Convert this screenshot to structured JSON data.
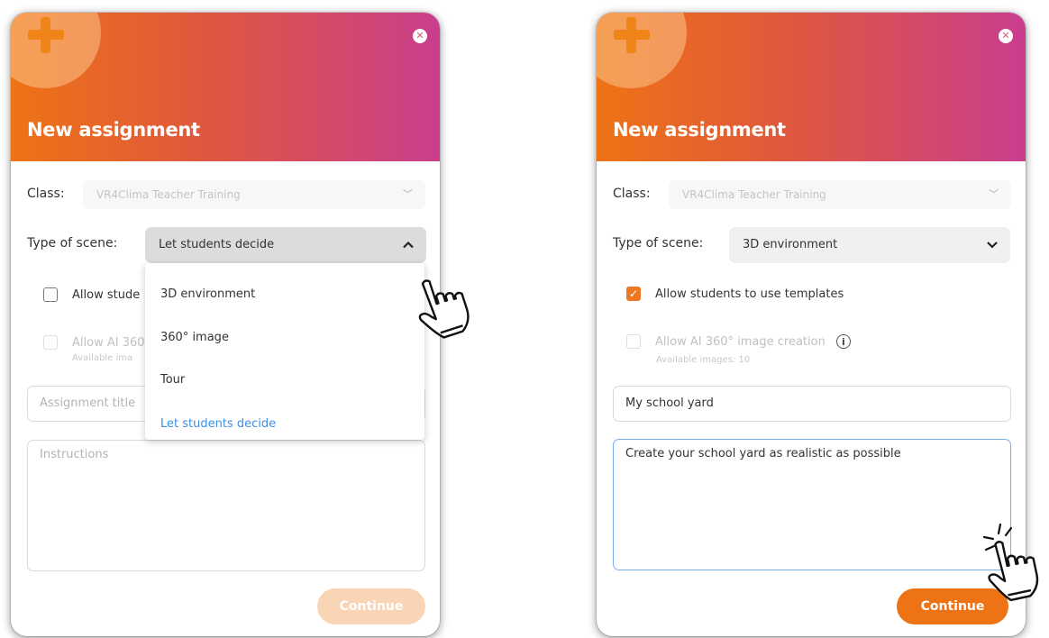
{
  "left_dialog": {
    "title": "New assignment",
    "class_label": "Class:",
    "class_value": "VR4Clima Teacher Training",
    "scene_label": "Type of scene:",
    "scene_value": "Let students decide",
    "templates_label_partial": "Allow stude",
    "ai_label_partial": "Allow AI 360",
    "ai_sub_partial": "Available ima",
    "title_placeholder_partial": "Assignment title",
    "instructions_placeholder": "Instructions",
    "continue_label": "Continue",
    "dropdown_options": [
      "3D environment",
      "360° image",
      "Tour",
      "Let students decide"
    ]
  },
  "right_dialog": {
    "title": "New assignment",
    "class_label": "Class:",
    "class_value": "VR4Clima Teacher Training",
    "scene_label": "Type of scene:",
    "scene_value": "3D environment",
    "templates_label": "Allow students to use templates",
    "templates_checked": true,
    "ai_label": "Allow AI 360° image creation",
    "ai_sub": "Available images: 10",
    "title_value": "My school yard",
    "instructions_value": "Create your school yard as realistic as possible",
    "continue_label": "Continue"
  },
  "colors": {
    "gradient_start": "#ee7315",
    "gradient_end": "#c93e8e",
    "accent_orange": "#ee7722",
    "link_blue": "#3d8fe6",
    "focus_blue": "#78aee6"
  }
}
